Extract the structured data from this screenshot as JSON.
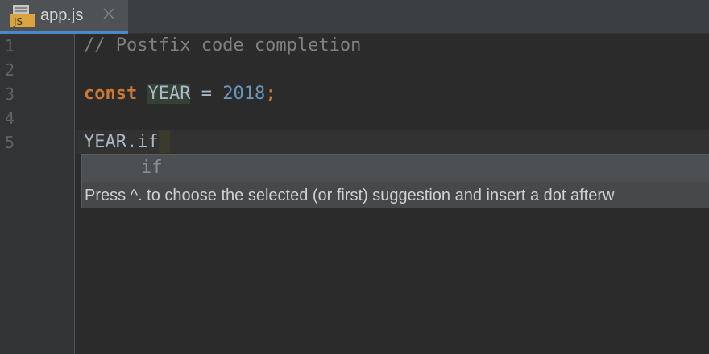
{
  "tab": {
    "file_name": "app.js",
    "icon_label": "JS",
    "icon": "js-file-icon",
    "close_icon": "close-icon"
  },
  "gutter": {
    "line_numbers": [
      "1",
      "2",
      "3",
      "4",
      "5"
    ]
  },
  "code": {
    "line1": {
      "comment": "// Postfix code completion"
    },
    "line3": {
      "keyword": "const",
      "identifier": "YEAR",
      "operator": " = ",
      "number": "2018",
      "semicolon": ";"
    },
    "line5": {
      "typed": "YEAR.if"
    }
  },
  "completion": {
    "items": [
      {
        "label": "if"
      }
    ],
    "hint": "Press ^. to choose the selected (or first) suggestion and insert a dot afterw"
  },
  "colors": {
    "background": "#2b2b2b",
    "tab_active_underline": "#4a88c7",
    "keyword": "#cc7832",
    "number": "#6897bb",
    "comment": "#808080"
  }
}
